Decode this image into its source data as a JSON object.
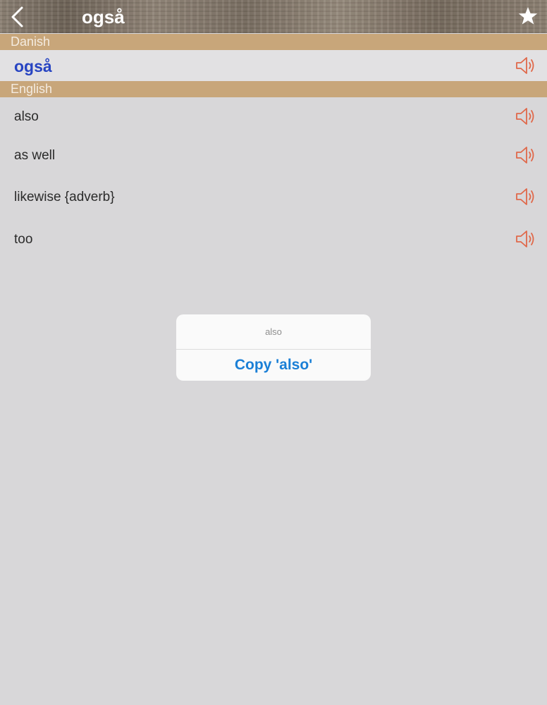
{
  "navbar": {
    "title": "også",
    "back_icon": "chevron-left-icon",
    "favorite_icon": "star-icon"
  },
  "danish_section": {
    "header": "Danish",
    "word": "også"
  },
  "english_section": {
    "header": "English",
    "translations": [
      "also",
      "as well",
      "likewise {adverb}",
      "too"
    ]
  },
  "popover": {
    "title": "also",
    "action_label": "Copy 'also'"
  },
  "colors": {
    "section_header_bg": "#c8a67a",
    "danish_word": "#2744c2",
    "speaker_icon": "#e0684a",
    "popover_action": "#1a7fd6",
    "background": "#d8d7d9"
  }
}
